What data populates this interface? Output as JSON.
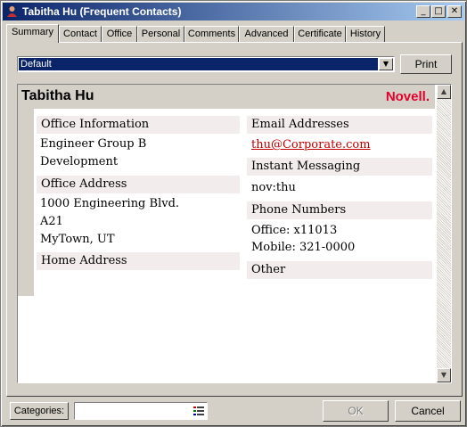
{
  "window": {
    "title": "Tabitha Hu (Frequent Contacts)",
    "minimize_glyph": "_",
    "maximize_glyph": "□",
    "close_glyph": "✕"
  },
  "tabs": [
    {
      "label": "Summary",
      "active": true
    },
    {
      "label": "Contact"
    },
    {
      "label": "Office"
    },
    {
      "label": "Personal"
    },
    {
      "label": "Comments"
    },
    {
      "label": "Advanced"
    },
    {
      "label": "Certificate"
    },
    {
      "label": "History"
    }
  ],
  "view_selector": {
    "value": "Default",
    "arrow": "▼"
  },
  "print_button": {
    "label": "Print"
  },
  "card": {
    "name": "Tabitha Hu",
    "brand": "Novell.",
    "office_info": {
      "heading": "Office Information",
      "lines": [
        "Engineer Group B",
        "Development"
      ]
    },
    "office_address": {
      "heading": "Office Address",
      "lines": [
        "1000 Engineering Blvd.",
        "A21",
        "MyTown, UT"
      ]
    },
    "home_address": {
      "heading": "Home Address"
    },
    "email": {
      "heading": "Email Addresses",
      "value": "thu@Corporate.com"
    },
    "im": {
      "heading": "Instant Messaging",
      "value": "nov:thu"
    },
    "phones": {
      "heading": "Phone Numbers",
      "lines": [
        "Office: x11013",
        "Mobile: 321-0000"
      ]
    },
    "other": {
      "heading": "Other"
    }
  },
  "scrollbar": {
    "up": "▲",
    "down": "▼"
  },
  "footer": {
    "categories_label": "Categories:",
    "ok_label": "OK",
    "cancel_label": "Cancel"
  },
  "colors": {
    "title_start": "#0a246a",
    "title_end": "#a6caf0",
    "brand": "#e4002b",
    "link": "#c00000",
    "section_bg": "#f3ecec"
  },
  "icons": {
    "title": "address-book-icon",
    "categories": "category-list-icon"
  }
}
